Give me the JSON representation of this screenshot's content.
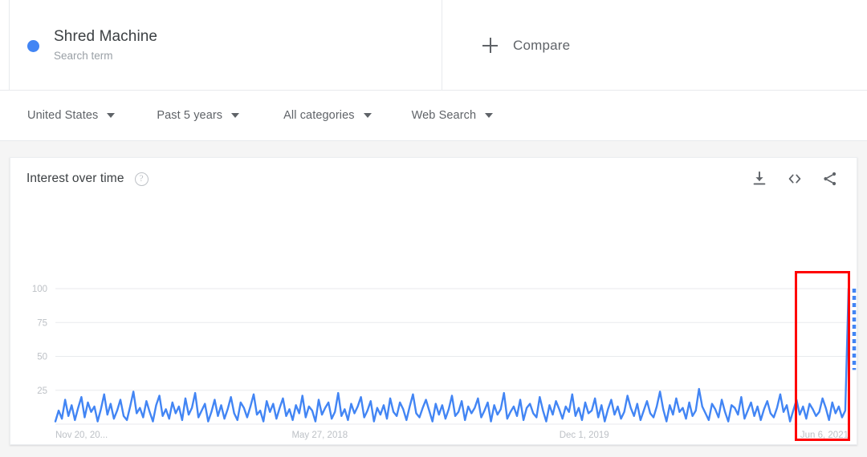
{
  "term": {
    "title": "Shred Machine",
    "subtitle": "Search term",
    "dot_color": "#4285f4"
  },
  "compare": {
    "label": "Compare",
    "icon": "plus-icon"
  },
  "filters": [
    {
      "label": "United States",
      "icon": "chevron-down-icon"
    },
    {
      "label": "Past 5 years",
      "icon": "chevron-down-icon"
    },
    {
      "label": "All categories",
      "icon": "chevron-down-icon"
    },
    {
      "label": "Web Search",
      "icon": "chevron-down-icon"
    }
  ],
  "chart_card": {
    "title": "Interest over time",
    "help_icon": "help-circle-icon",
    "help_glyph": "?",
    "actions": [
      {
        "name": "download-icon"
      },
      {
        "name": "embed-code-icon"
      },
      {
        "name": "share-icon"
      }
    ]
  },
  "annotation": {
    "shape": "rectangle",
    "color": "#ff0000",
    "note": "highlight around final spike"
  },
  "chart_data": {
    "type": "line",
    "title": "Interest over time",
    "xlabel": "",
    "ylabel": "",
    "ylim": [
      0,
      100
    ],
    "yticks": [
      25,
      50,
      75,
      100
    ],
    "grid": true,
    "legend": "none",
    "line_color": "#4285f4",
    "xtick_labels": [
      "Nov 20, 20...",
      "May 27, 2018",
      "Dec 1, 2019",
      "Jun 6, 2021"
    ],
    "xtick_positions": [
      0,
      0.3333,
      0.6667,
      1.0
    ],
    "partial_data_tail": {
      "style": "dotted",
      "from": 40,
      "to": 100
    },
    "values": [
      2,
      10,
      4,
      18,
      6,
      14,
      3,
      12,
      20,
      5,
      16,
      9,
      13,
      2,
      11,
      22,
      7,
      15,
      4,
      10,
      18,
      6,
      3,
      13,
      24,
      8,
      12,
      5,
      17,
      9,
      2,
      14,
      21,
      6,
      11,
      4,
      16,
      8,
      13,
      3,
      19,
      7,
      12,
      23,
      5,
      10,
      15,
      2,
      9,
      18,
      6,
      14,
      4,
      11,
      20,
      8,
      3,
      16,
      12,
      5,
      13,
      22,
      7,
      10,
      2,
      17,
      9,
      15,
      4,
      12,
      19,
      6,
      11,
      3,
      14,
      8,
      21,
      5,
      13,
      10,
      2,
      18,
      7,
      12,
      16,
      4,
      9,
      23,
      6,
      11,
      3,
      15,
      8,
      13,
      20,
      5,
      10,
      17,
      2,
      12,
      7,
      14,
      4,
      19,
      9,
      6,
      16,
      11,
      3,
      13,
      22,
      8,
      5,
      12,
      18,
      10,
      2,
      15,
      7,
      14,
      4,
      11,
      21,
      6,
      9,
      17,
      3,
      13,
      8,
      12,
      19,
      5,
      10,
      16,
      2,
      14,
      7,
      11,
      23,
      4,
      9,
      13,
      6,
      18,
      3,
      12,
      15,
      8,
      5,
      20,
      10,
      2,
      14,
      7,
      17,
      11,
      4,
      13,
      9,
      22,
      6,
      12,
      3,
      16,
      8,
      10,
      19,
      5,
      14,
      2,
      11,
      18,
      7,
      13,
      4,
      9,
      21,
      12,
      6,
      15,
      3,
      10,
      17,
      8,
      5,
      13,
      24,
      11,
      2,
      14,
      7,
      19,
      9,
      12,
      4,
      16,
      6,
      10,
      26,
      13,
      8,
      3,
      15,
      11,
      5,
      18,
      9,
      2,
      14,
      12,
      7,
      20,
      4,
      10,
      16,
      6,
      13,
      3,
      11,
      17,
      8,
      5,
      12,
      22,
      9,
      14,
      2,
      10,
      18,
      7,
      13,
      4,
      15,
      11,
      6,
      9,
      19,
      12,
      3,
      16,
      8,
      13,
      5,
      10,
      100
    ]
  }
}
